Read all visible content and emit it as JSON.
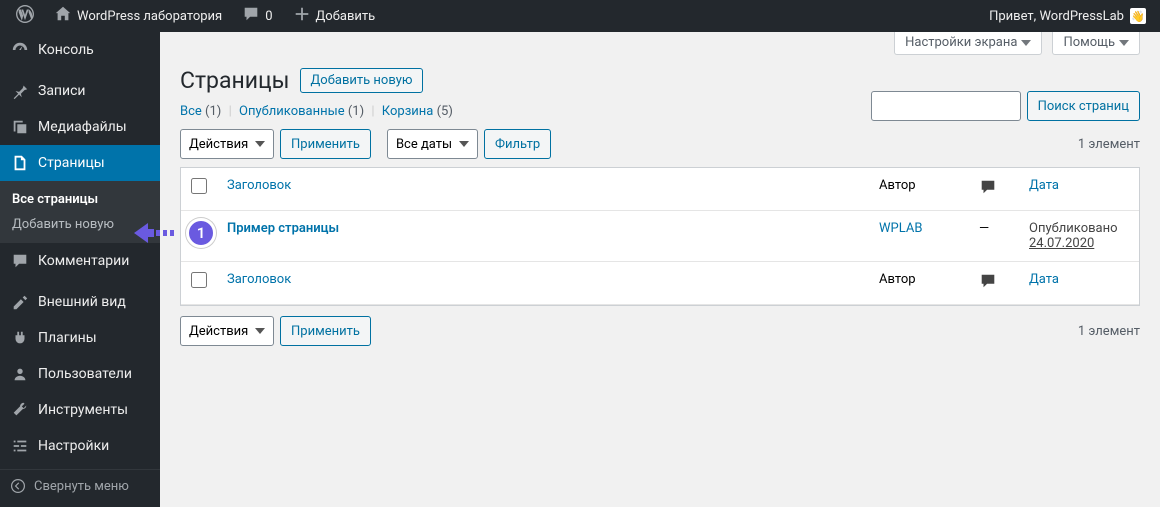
{
  "adminbar": {
    "site_name": "WordPress лаборатория",
    "comments_count": "0",
    "add_new": "Добавить",
    "greeting": "Привет, WordPressLab",
    "avatar_emoji": "👋"
  },
  "sidebar": {
    "items": [
      {
        "label": "Консоль",
        "icon": "dashboard"
      },
      {
        "label": "Записи",
        "icon": "pin"
      },
      {
        "label": "Медиафайлы",
        "icon": "media"
      },
      {
        "label": "Страницы",
        "icon": "page",
        "current": true
      },
      {
        "label": "Комментарии",
        "icon": "comment"
      },
      {
        "label": "Внешний вид",
        "icon": "appearance"
      },
      {
        "label": "Плагины",
        "icon": "plugin"
      },
      {
        "label": "Пользователи",
        "icon": "user"
      },
      {
        "label": "Инструменты",
        "icon": "tools"
      },
      {
        "label": "Настройки",
        "icon": "settings"
      }
    ],
    "submenu": [
      {
        "label": "Все страницы",
        "current": true
      },
      {
        "label": "Добавить новую"
      }
    ],
    "collapse": "Свернуть меню"
  },
  "screen_meta": {
    "screen_options": "Настройки экрана",
    "help": "Помощь"
  },
  "page": {
    "title": "Страницы",
    "add_new": "Добавить новую"
  },
  "filters": {
    "all": "Все",
    "all_count": "(1)",
    "published": "Опубликованные",
    "published_count": "(1)",
    "trash": "Корзина",
    "trash_count": "(5)"
  },
  "search": {
    "button": "Поиск страниц",
    "value": ""
  },
  "bulk": {
    "action_placeholder": "Действия",
    "apply": "Применить",
    "date_placeholder": "Все даты",
    "filter": "Фильтр"
  },
  "pagination": {
    "count_text": "1 элемент"
  },
  "table": {
    "columns": {
      "title": "Заголовок",
      "author": "Автор",
      "date": "Дата"
    },
    "rows": [
      {
        "title": "Пример страницы",
        "author": "WPLAB",
        "comments": "—",
        "date_status": "Опубликовано",
        "date": "24.07.2020"
      }
    ]
  },
  "callout": {
    "number": "1"
  }
}
